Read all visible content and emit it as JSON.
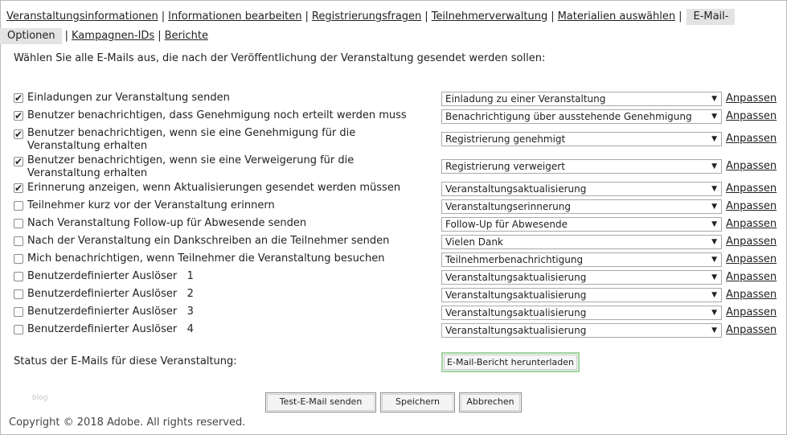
{
  "nav": {
    "items": [
      {
        "label": "Veranstaltungsinformationen"
      },
      {
        "label": "Informationen bearbeiten"
      },
      {
        "label": "Registrierungsfragen"
      },
      {
        "label": "Teilnehmerverwaltung"
      },
      {
        "label": "Materialien auswählen"
      },
      {
        "label_part1": "E-Mail-",
        "label_part2": "Optionen"
      },
      {
        "label": "Kampagnen-IDs"
      },
      {
        "label": "Berichte"
      }
    ],
    "separator": "|"
  },
  "intro": "Wählen Sie alle E-Mails aus, die nach der Veröffentlichung der Veranstaltung gesendet werden sollen:",
  "customize_label": "Anpassen",
  "rows": [
    {
      "label": "Einladungen zur Veranstaltung senden",
      "checked": true,
      "select": "Einladung zu einer Veranstaltung"
    },
    {
      "label": "Benutzer benachrichtigen, dass Genehmigung noch erteilt werden muss",
      "checked": true,
      "select": "Benachrichtigung über ausstehende Genehmigung"
    },
    {
      "label": "Benutzer benachrichtigen, wenn sie eine Genehmigung für die Veranstaltung erhalten",
      "checked": true,
      "select": "Registrierung genehmigt"
    },
    {
      "label": "Benutzer benachrichtigen, wenn sie eine Verweigerung für die Veranstaltung erhalten",
      "checked": true,
      "select": "Registrierung verweigert"
    },
    {
      "label": "Erinnerung anzeigen, wenn Aktualisierungen gesendet werden müssen",
      "checked": true,
      "select": "Veranstaltungsaktualisierung"
    },
    {
      "label": "Teilnehmer kurz vor der Veranstaltung erinnern",
      "checked": false,
      "select": "Veranstaltungserinnerung"
    },
    {
      "label": "Nach Veranstaltung Follow-up für Abwesende senden",
      "checked": false,
      "select": "Follow-Up für Abwesende"
    },
    {
      "label": "Nach der Veranstaltung ein Dankschreiben an die Teilnehmer senden",
      "checked": false,
      "select": "Vielen Dank"
    },
    {
      "label": "Mich benachrichtigen, wenn Teilnehmer die Veranstaltung besuchen",
      "checked": false,
      "select": "Teilnehmerbenachrichtigung"
    },
    {
      "label": "Benutzerdefinierter Auslöser   1",
      "checked": false,
      "select": "Veranstaltungsaktualisierung"
    },
    {
      "label": "Benutzerdefinierter Auslöser   2",
      "checked": false,
      "select": "Veranstaltungsaktualisierung"
    },
    {
      "label": "Benutzerdefinierter Auslöser   3",
      "checked": false,
      "select": "Veranstaltungsaktualisierung"
    },
    {
      "label": "Benutzerdefinierter Auslöser   4",
      "checked": false,
      "select": "Veranstaltungsaktualisierung"
    }
  ],
  "status": {
    "label": "Status der E-Mails für diese Veranstaltung:",
    "button": "E-Mail-Bericht herunterladen"
  },
  "watermark": "blog",
  "buttons": {
    "test": "Test-E-Mail senden",
    "save": "Speichern",
    "cancel": "Abbrechen"
  },
  "footer": "Copyright © 2018 Adobe. All rights reserved.",
  "icons": {
    "dropdown_arrow": "▼"
  }
}
